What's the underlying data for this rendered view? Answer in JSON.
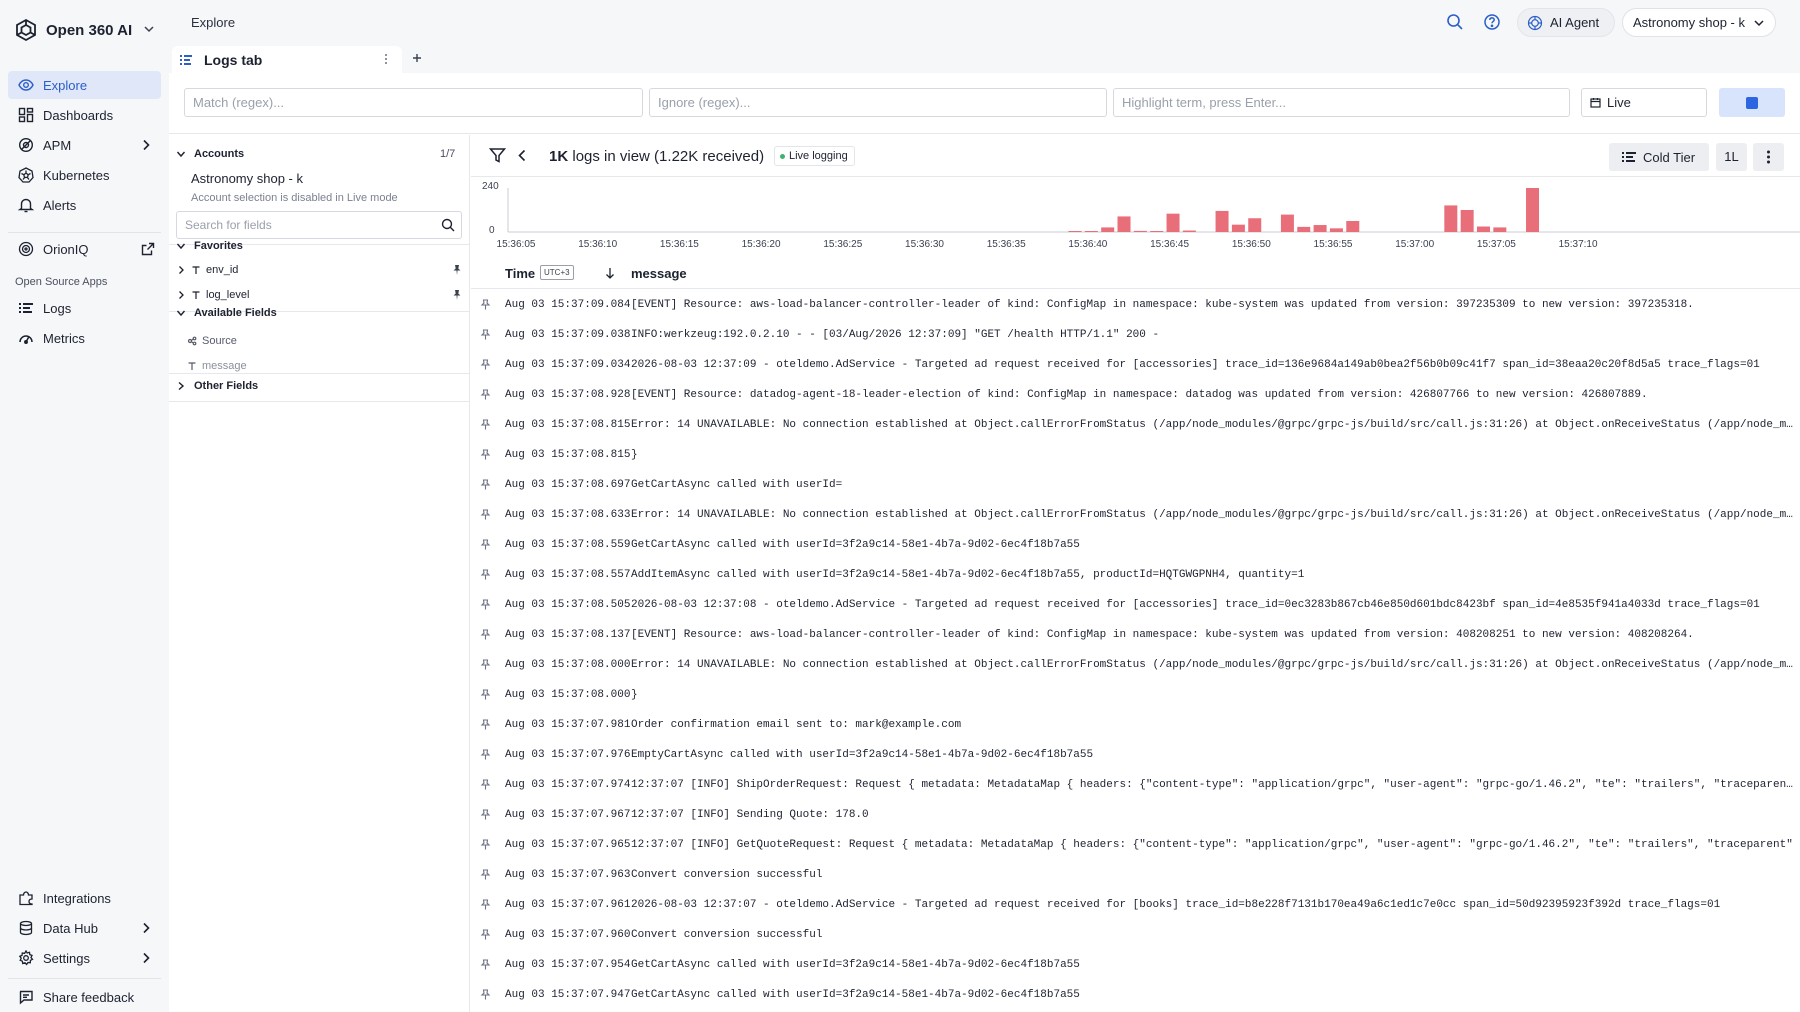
{
  "brand": {
    "name": "Open 360 AI"
  },
  "sidebar": {
    "items": [
      {
        "label": "Explore",
        "icon": "eye-icon"
      },
      {
        "label": "Dashboards",
        "icon": "dashboard-icon"
      },
      {
        "label": "APM",
        "icon": "apm-icon"
      },
      {
        "label": "Kubernetes",
        "icon": "kubernetes-icon"
      },
      {
        "label": "Alerts",
        "icon": "bell-icon"
      },
      {
        "label": "OrionIQ",
        "icon": "orion-icon"
      }
    ],
    "section_label": "Open Source Apps",
    "apps": [
      {
        "label": "Logs",
        "icon": "logs-icon"
      },
      {
        "label": "Metrics",
        "icon": "metrics-icon"
      }
    ],
    "bottom": [
      {
        "label": "Integrations",
        "icon": "puzzle-icon"
      },
      {
        "label": "Data Hub",
        "icon": "database-icon"
      },
      {
        "label": "Settings",
        "icon": "gear-icon"
      }
    ],
    "feedback": "Share feedback"
  },
  "topbar": {
    "breadcrumb": "Explore",
    "ai_agent": "AI Agent",
    "account": "Astronomy shop - k"
  },
  "tab": {
    "label": "Logs tab"
  },
  "filters": {
    "match_placeholder": "Match (regex)...",
    "ignore_placeholder": "Ignore (regex)...",
    "highlight_placeholder": "Highlight term, press Enter...",
    "time_mode": "Live"
  },
  "fields_panel": {
    "accounts_label": "Accounts",
    "accounts_count": "1/7",
    "account_name": "Astronomy shop - k",
    "account_note": "Account selection is disabled in Live mode",
    "search_placeholder": "Search for fields",
    "favorites_label": "Favorites",
    "favorites": [
      "env_id",
      "log_level"
    ],
    "available_label": "Available Fields",
    "available": [
      "Source",
      "message"
    ],
    "other_label": "Other Fields"
  },
  "logs_header": {
    "count_bold": "1K",
    "count_rest": "logs in view (1.22K received)",
    "live_badge": "Live logging",
    "cold_tier": "Cold Tier",
    "one_l": "1L"
  },
  "chart_data": {
    "type": "bar",
    "ylim": [
      0,
      240
    ],
    "y_ticks": [
      "240",
      "0"
    ],
    "x_ticks": [
      "15:36:05",
      "15:36:10",
      "15:36:15",
      "15:36:20",
      "15:36:25",
      "15:36:30",
      "15:36:35",
      "15:36:40",
      "15:36:45",
      "15:36:50",
      "15:36:55",
      "15:37:00",
      "15:37:05",
      "15:37:10"
    ],
    "bars": [
      {
        "t": 39.7,
        "v": 4
      },
      {
        "t": 40.7,
        "v": 4
      },
      {
        "t": 41.7,
        "v": 25
      },
      {
        "t": 42.7,
        "v": 85
      },
      {
        "t": 43.7,
        "v": 6
      },
      {
        "t": 44.7,
        "v": 4
      },
      {
        "t": 45.7,
        "v": 100
      },
      {
        "t": 46.7,
        "v": 8
      },
      {
        "t": 48.7,
        "v": 115
      },
      {
        "t": 49.7,
        "v": 40
      },
      {
        "t": 50.7,
        "v": 75
      },
      {
        "t": 52.7,
        "v": 95
      },
      {
        "t": 53.7,
        "v": 28
      },
      {
        "t": 54.7,
        "v": 38
      },
      {
        "t": 55.7,
        "v": 20
      },
      {
        "t": 56.7,
        "v": 60
      },
      {
        "t": 62.7,
        "v": 145
      },
      {
        "t": 63.7,
        "v": 120
      },
      {
        "t": 64.7,
        "v": 30
      },
      {
        "t": 65.7,
        "v": 25
      },
      {
        "t": 67.7,
        "v": 240
      }
    ]
  },
  "table": {
    "time_header": "Time",
    "tz": "UTC+3",
    "message_header": "message",
    "rows": [
      {
        "time": "Aug 03 15:37:09.084",
        "message": "[EVENT] Resource: aws-load-balancer-controller-leader of kind: ConfigMap in namespace: kube-system was updated from version: 397235309 to new version: 397235318."
      },
      {
        "time": "Aug 03 15:37:09.038",
        "message": "INFO:werkzeug:192.0.2.10 - - [03/Aug/2026 12:37:09] \"GET /health HTTP/1.1\" 200 -"
      },
      {
        "time": "Aug 03 15:37:09.034",
        "message": "2026-08-03 12:37:09 - oteldemo.AdService - Targeted ad request received for [accessories] trace_id=136e9684a149ab0bea2f56b0b09c41f7 span_id=38eaa20c20f8d5a5 trace_flags=01"
      },
      {
        "time": "Aug 03 15:37:08.928",
        "message": "[EVENT] Resource: datadog-agent-18-leader-election of kind: ConfigMap in namespace: datadog was updated from version: 426807766 to new version: 426807889."
      },
      {
        "time": "Aug 03 15:37:08.815",
        "message": "Error: 14 UNAVAILABLE: No connection established at Object.callErrorFromStatus (/app/node_modules/@grpc/grpc-js/build/src/call.js:31:26) at Object.onReceiveStatus (/app/node_modules"
      },
      {
        "time": "Aug 03 15:37:08.815",
        "message": "}"
      },
      {
        "time": "Aug 03 15:37:08.697",
        "message": "GetCartAsync called with userId="
      },
      {
        "time": "Aug 03 15:37:08.633",
        "message": "Error: 14 UNAVAILABLE: No connection established at Object.callErrorFromStatus (/app/node_modules/@grpc/grpc-js/build/src/call.js:31:26) at Object.onReceiveStatus (/app/node_modules"
      },
      {
        "time": "Aug 03 15:37:08.559",
        "message": "GetCartAsync called with userId=3f2a9c14-58e1-4b7a-9d02-6ec4f18b7a55"
      },
      {
        "time": "Aug 03 15:37:08.557",
        "message": "AddItemAsync called with userId=3f2a9c14-58e1-4b7a-9d02-6ec4f18b7a55, productId=HQTGWGPNH4, quantity=1"
      },
      {
        "time": "Aug 03 15:37:08.505",
        "message": "2026-08-03 12:37:08 - oteldemo.AdService - Targeted ad request received for [accessories] trace_id=0ec3283b867cb46e850d601bdc8423bf span_id=4e8535f941a4033d trace_flags=01"
      },
      {
        "time": "Aug 03 15:37:08.137",
        "message": "[EVENT] Resource: aws-load-balancer-controller-leader of kind: ConfigMap in namespace: kube-system was updated from version: 408208251 to new version: 408208264."
      },
      {
        "time": "Aug 03 15:37:08.000",
        "message": "Error: 14 UNAVAILABLE: No connection established at Object.callErrorFromStatus (/app/node_modules/@grpc/grpc-js/build/src/call.js:31:26) at Object.onReceiveStatus (/app/node_modules"
      },
      {
        "time": "Aug 03 15:37:08.000",
        "message": "}"
      },
      {
        "time": "Aug 03 15:37:07.981",
        "message": "Order confirmation email sent to: mark@example.com"
      },
      {
        "time": "Aug 03 15:37:07.976",
        "message": "EmptyCartAsync called with userId=3f2a9c14-58e1-4b7a-9d02-6ec4f18b7a55"
      },
      {
        "time": "Aug 03 15:37:07.974",
        "message": "12:37:07 [INFO] ShipOrderRequest: Request { metadata: MetadataMap { headers: {\"content-type\": \"application/grpc\", \"user-agent\": \"grpc-go/1.46.2\", \"te\": \"trailers\", \"traceparent\""
      },
      {
        "time": "Aug 03 15:37:07.967",
        "message": "12:37:07 [INFO] Sending Quote: 178.0"
      },
      {
        "time": "Aug 03 15:37:07.965",
        "message": "12:37:07 [INFO] GetQuoteRequest: Request { metadata: MetadataMap { headers: {\"content-type\": \"application/grpc\", \"user-agent\": \"grpc-go/1.46.2\", \"te\": \"trailers\", \"traceparent\""
      },
      {
        "time": "Aug 03 15:37:07.963",
        "message": "Convert conversion successful"
      },
      {
        "time": "Aug 03 15:37:07.961",
        "message": "2026-08-03 12:37:07 - oteldemo.AdService - Targeted ad request received for [books] trace_id=b8e228f7131b170ea49a6c1ed1c7e0cc span_id=50d92395923f392d trace_flags=01"
      },
      {
        "time": "Aug 03 15:37:07.960",
        "message": "Convert conversion successful"
      },
      {
        "time": "Aug 03 15:37:07.954",
        "message": "GetCartAsync called with userId=3f2a9c14-58e1-4b7a-9d02-6ec4f18b7a55"
      },
      {
        "time": "Aug 03 15:37:07.947",
        "message": "GetCartAsync called with userId=3f2a9c14-58e1-4b7a-9d02-6ec4f18b7a55"
      }
    ]
  }
}
